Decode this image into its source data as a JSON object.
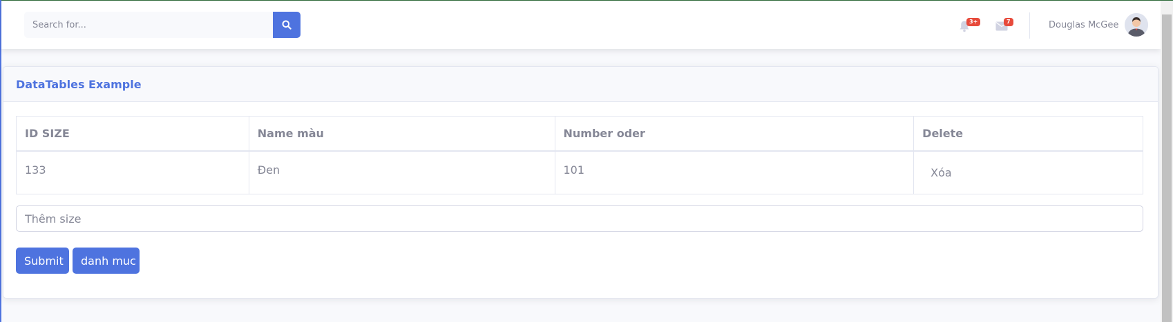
{
  "topbar": {
    "search_placeholder": "Search for...",
    "alerts_badge": "3+",
    "messages_badge": "7",
    "user_name": "Douglas McGee"
  },
  "card": {
    "title": "DataTables Example",
    "table": {
      "headers": [
        "ID SIZE",
        "Name màu",
        "Number oder",
        "Delete"
      ],
      "rows": [
        {
          "id": "133",
          "name": "Đen",
          "number": "101",
          "delete_label": "Xóa"
        }
      ]
    },
    "input_placeholder": "Thêm size",
    "submit_label": "Submit",
    "category_label": "danh muc"
  },
  "colors": {
    "primary": "#4e73df",
    "badge": "#e74a3b",
    "text": "#858796"
  }
}
